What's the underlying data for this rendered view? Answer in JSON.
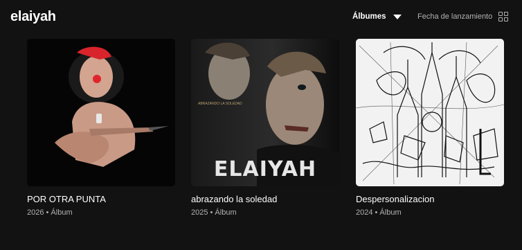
{
  "header": {
    "artist_name": "elaiyah",
    "filter_label": "Álbumes",
    "sort_label": "Fecha de lanzamiento"
  },
  "albums": [
    {
      "title": "POR OTRA PUNTA",
      "year": "2026",
      "type": "Álbum",
      "subtitle": "2026 • Álbum"
    },
    {
      "title": "abrazando la soledad",
      "year": "2025",
      "type": "Álbum",
      "subtitle": "2025 • Álbum",
      "cover_text": "ELAIYAH",
      "cover_small_text": "ABRAZANDO LA SOLEDAD"
    },
    {
      "title": "Despersonalizacion",
      "year": "2024",
      "type": "Álbum",
      "subtitle": "2024 • Álbum"
    }
  ],
  "icons": {
    "filter": "chevron-down-icon",
    "view": "grid-view-icon"
  },
  "colors": {
    "background": "#121212",
    "text_primary": "#ffffff",
    "text_secondary": "#b3b3b3"
  }
}
